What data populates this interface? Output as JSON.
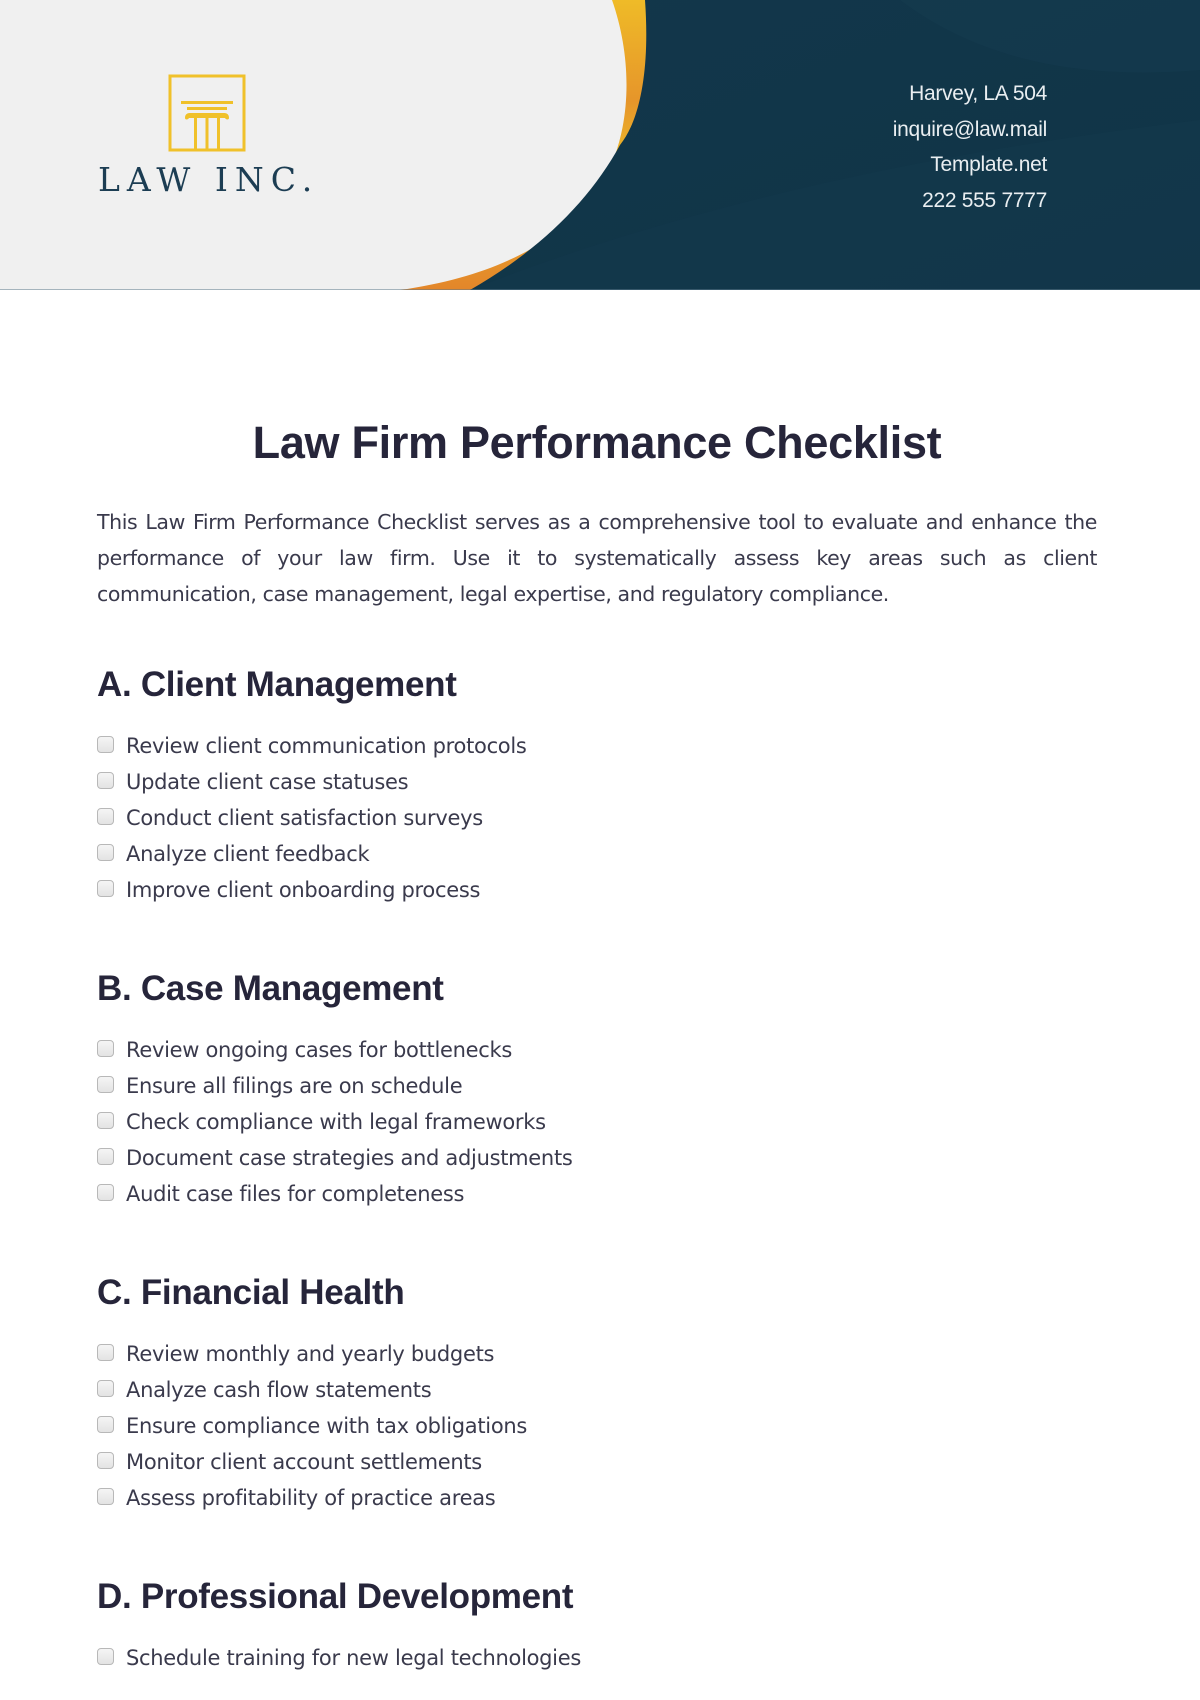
{
  "header": {
    "logo": {
      "icon": "pillar-icon",
      "name": "LAW INC."
    },
    "contact": {
      "address": "Harvey, LA 504",
      "email": "inquire@law.mail",
      "website": "Template.net",
      "phone": "222 555 7777"
    },
    "colors": {
      "navy": "#12374a",
      "gold": "#f0c12a",
      "orange": "#e5892a",
      "light_bg": "#f0f0f0"
    }
  },
  "document": {
    "title": "Law Firm Performance Checklist",
    "intro": "This Law Firm Performance Checklist serves as a comprehensive tool to evaluate and enhance the performance of your law firm. Use it to systematically assess key areas such as client communication, case management, legal expertise, and regulatory compliance.",
    "sections": [
      {
        "title": "A. Client Management",
        "items": [
          {
            "label": "Review client communication protocols",
            "checked": false
          },
          {
            "label": "Update client case statuses",
            "checked": false
          },
          {
            "label": "Conduct client satisfaction surveys",
            "checked": false
          },
          {
            "label": "Analyze client feedback",
            "checked": false
          },
          {
            "label": "Improve client onboarding process",
            "checked": false
          }
        ]
      },
      {
        "title": "B. Case Management",
        "items": [
          {
            "label": "Review ongoing cases for bottlenecks",
            "checked": false
          },
          {
            "label": "Ensure all filings are on schedule",
            "checked": false
          },
          {
            "label": "Check compliance with legal frameworks",
            "checked": false
          },
          {
            "label": "Document case strategies and adjustments",
            "checked": false
          },
          {
            "label": "Audit case files for completeness",
            "checked": false
          }
        ]
      },
      {
        "title": "C. Financial Health",
        "items": [
          {
            "label": "Review monthly and yearly budgets",
            "checked": false
          },
          {
            "label": "Analyze cash flow statements",
            "checked": false
          },
          {
            "label": "Ensure compliance with tax obligations",
            "checked": false
          },
          {
            "label": "Monitor client account settlements",
            "checked": false
          },
          {
            "label": "Assess profitability of practice areas",
            "checked": false
          }
        ]
      },
      {
        "title": "D. Professional Development",
        "items": [
          {
            "label": "Schedule training for new legal technologies",
            "checked": false
          }
        ]
      }
    ]
  }
}
